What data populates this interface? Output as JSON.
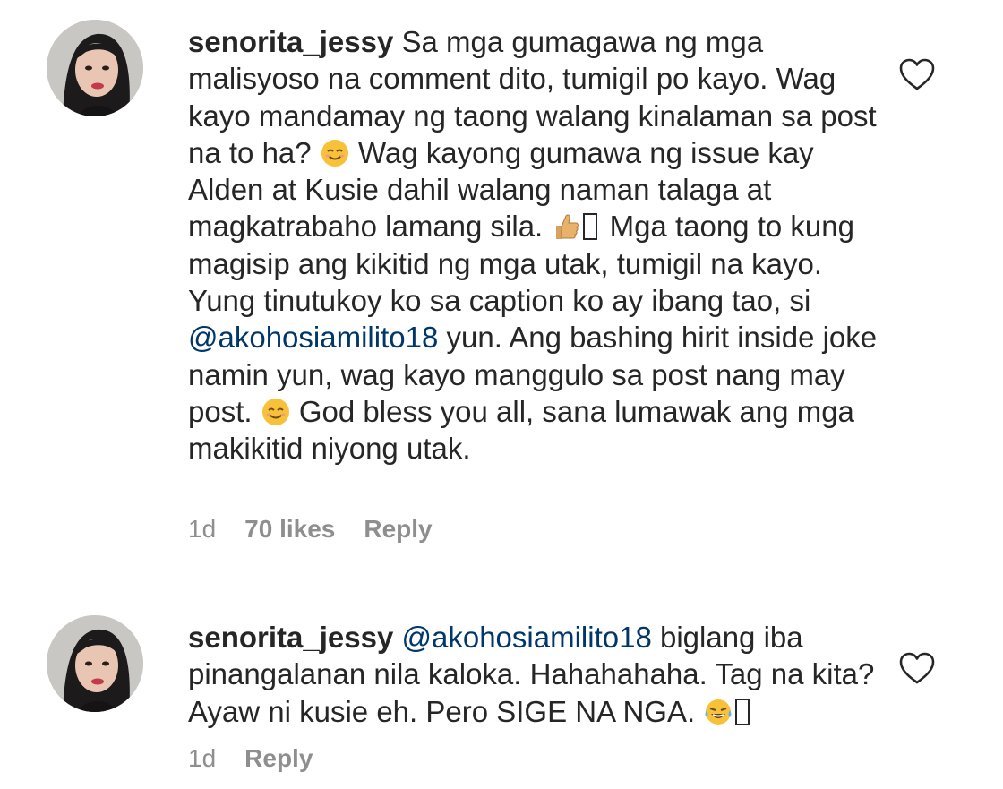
{
  "comments": [
    {
      "username": "senorita_jessy",
      "parts": {
        "p1": "Sa mga gumagawa ng mga malisyoso na comment dito, tumigil po kayo. Wag kayo mandamay ng taong walang kinalaman sa post na to ha?",
        "p2": "Wag kayong gumawa ng issue kay Alden at Kusie dahil walang naman talaga at magkatrabaho lamang sila.",
        "p3": "Mga taong to kung magisip ang kikitid ng mga utak, tumigil na kayo. Yung tinutukoy ko sa caption ko ay ibang tao, si",
        "mention": "@akohosiamilito18",
        "p4": "yun. Ang bashing hirit inside joke namin yun, wag kayo manggulo sa post nang may post.",
        "p5": "God bless you all, sana lumawak ang mga makikitid niyong utak."
      },
      "time": "1d",
      "likes": "70 likes",
      "reply": "Reply"
    },
    {
      "username": "senorita_jessy",
      "parts": {
        "mention": "@akohosiamilito18",
        "p1": "biglang iba pinangalanan nila kaloka. Hahahahaha. Tag na kita? Ayaw ni kusie eh. Pero SIGE NA NGA."
      },
      "time": "1d",
      "reply": "Reply"
    }
  ],
  "icons": {
    "avatar": "profile-photo",
    "like": "heart-outline-icon",
    "emoji_smile": "smiling-face-emoji",
    "emoji_thumb": "thumbs-up-emoji",
    "emoji_laugh": "tears-of-joy-emoji"
  },
  "colors": {
    "text": "#262626",
    "muted": "#8e8e8e",
    "mention": "#00376b"
  }
}
